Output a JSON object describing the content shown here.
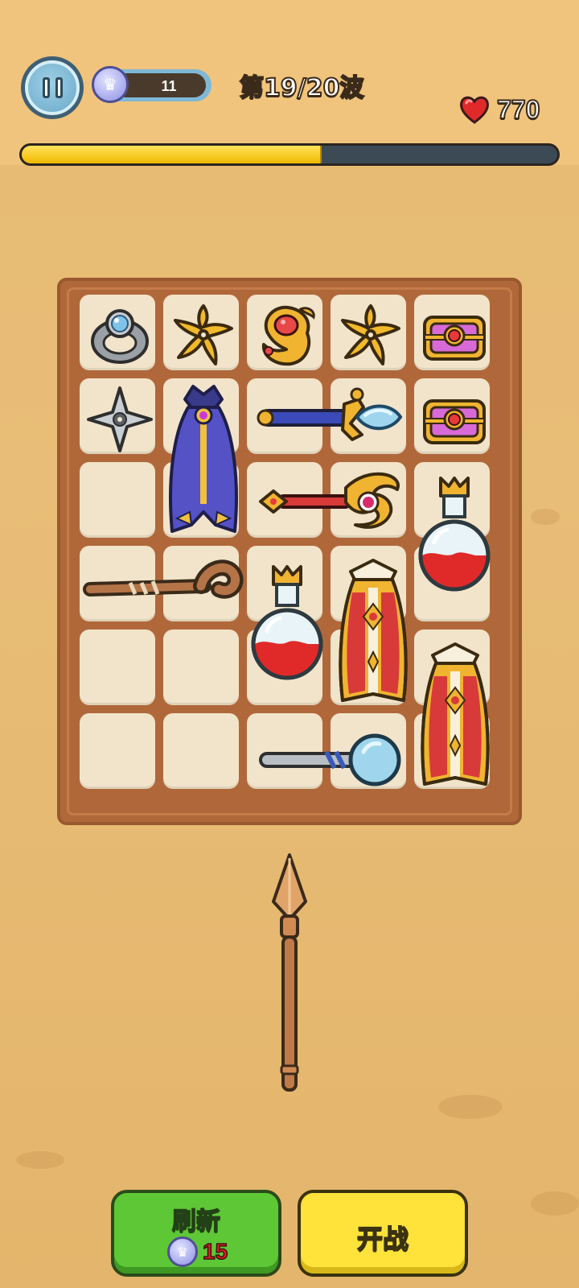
{
  "hud": {
    "level_value": "11",
    "wave_label": "第19/20波",
    "hp_value": "770",
    "wave_progress": 0.56
  },
  "board": {
    "columns": 5,
    "rows": 6
  },
  "items": [
    {
      "name": "silver-ring-icon"
    },
    {
      "name": "gold-shuriken-icon"
    },
    {
      "name": "gold-amulet-icon"
    },
    {
      "name": "gold-shuriken-icon"
    },
    {
      "name": "treasure-chest-icon"
    },
    {
      "name": "silver-shuriken-icon"
    },
    {
      "name": "purple-cape-icon"
    },
    {
      "name": "crystal-wand-icon"
    },
    {
      "name": "treasure-chest-icon"
    },
    {
      "name": "ruby-scepter-icon"
    },
    {
      "name": "red-potion-icon"
    },
    {
      "name": "wooden-crook-staff-icon"
    },
    {
      "name": "red-potion-icon"
    },
    {
      "name": "royal-robe-icon"
    },
    {
      "name": "royal-robe-icon"
    },
    {
      "name": "magnifier-wand-icon"
    }
  ],
  "floating_item": {
    "name": "wooden-spear-icon"
  },
  "buttons": {
    "refresh_label": "刷新",
    "refresh_cost": "15",
    "battle_label": "开战"
  },
  "colors": {
    "sand": "#e7bb74",
    "board": "#b0683a",
    "cell": "#f2e4ca",
    "refresh_green": "#5ec736",
    "battle_yellow": "#ffe23a",
    "progress_fill": "#f0b800"
  }
}
